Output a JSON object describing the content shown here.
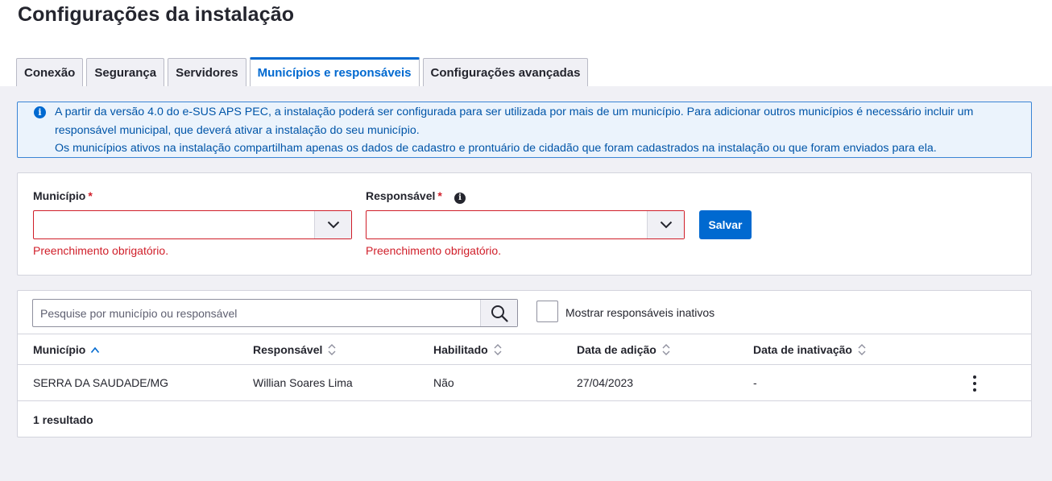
{
  "page": {
    "title": "Configurações da instalação"
  },
  "tabs": [
    {
      "label": "Conexão",
      "active": false
    },
    {
      "label": "Segurança",
      "active": false
    },
    {
      "label": "Servidores",
      "active": false
    },
    {
      "label": "Municípios e responsáveis",
      "active": true
    },
    {
      "label": "Configurações avançadas",
      "active": false
    }
  ],
  "info": {
    "icon": "info-icon",
    "line1": "A partir da versão 4.0 do e-SUS APS PEC, a instalação poderá ser configurada para ser utilizada por mais de um município. Para adicionar outros municípios é necessário incluir um",
    "line2": "responsável municipal, que deverá ativar a instalação do seu município.",
    "line3": "Os municípios ativos na instalação compartilham apenas os dados de cadastro e prontuário de cidadão que foram cadastrados na instalação ou que foram enviados para ela."
  },
  "form": {
    "municipio": {
      "label": "Município",
      "required_mark": "*",
      "value": "",
      "error": "Preenchimento obrigatório."
    },
    "responsavel": {
      "label": "Responsável",
      "required_mark": "*",
      "value": "",
      "error": "Preenchimento obrigatório.",
      "help_icon": "help-icon"
    },
    "save_label": "Salvar"
  },
  "search": {
    "placeholder": "Pesquise por município ou responsável",
    "value": ""
  },
  "filter": {
    "show_inactive_label": "Mostrar responsáveis inativos",
    "checked": false
  },
  "table": {
    "columns": [
      {
        "label": "Município",
        "sort": "asc"
      },
      {
        "label": "Responsável",
        "sort": "none"
      },
      {
        "label": "Habilitado",
        "sort": "none"
      },
      {
        "label": "Data de adição",
        "sort": "none"
      },
      {
        "label": "Data de inativação",
        "sort": "none"
      }
    ],
    "rows": [
      {
        "municipio": "SERRA DA SAUDADE/MG",
        "responsavel": "Willian Soares Lima",
        "habilitado": "Não",
        "data_adicao": "27/04/2023",
        "data_inativacao": "-"
      }
    ],
    "result_count": "1 resultado"
  },
  "colors": {
    "primary": "#0069d0",
    "error": "#d01e29",
    "info_bg": "#ebf3fc",
    "page_bg": "#f0f0f5"
  }
}
